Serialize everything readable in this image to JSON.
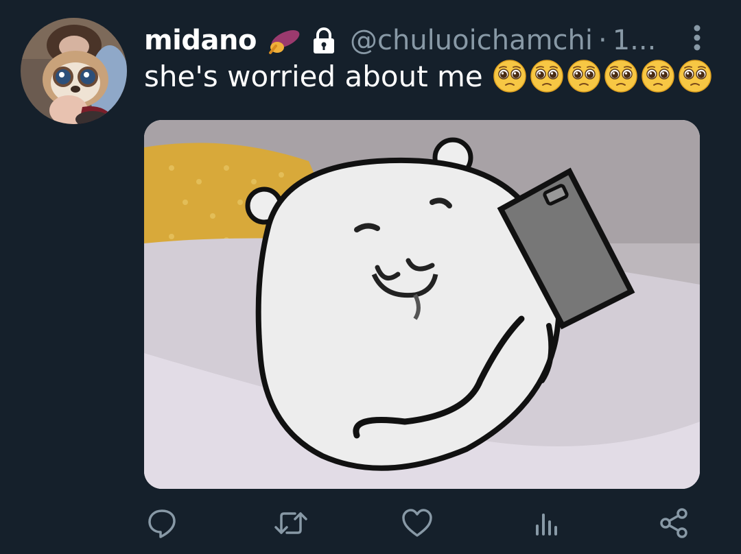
{
  "tweet": {
    "display_name": "midano",
    "name_badge_icon": "sweet-potato-icon",
    "protected_icon": "lock-icon",
    "handle": "@chuluoichamchi",
    "separator": "·",
    "timestamp": "1...",
    "text": "she's worried about me",
    "emoji_name": "pleading-face-emoji",
    "emoji_count": 6,
    "media_description_icon": "bear-with-phone-image"
  },
  "actions": [
    {
      "name": "reply",
      "icon": "reply-icon"
    },
    {
      "name": "retweet",
      "icon": "retweet-icon"
    },
    {
      "name": "like",
      "icon": "heart-icon"
    },
    {
      "name": "analytics",
      "icon": "analytics-icon"
    },
    {
      "name": "share",
      "icon": "share-icon"
    }
  ],
  "colors": {
    "background": "#15202b",
    "text_primary": "#ffffff",
    "text_secondary": "#8899a6",
    "icon": "#8899a6"
  }
}
